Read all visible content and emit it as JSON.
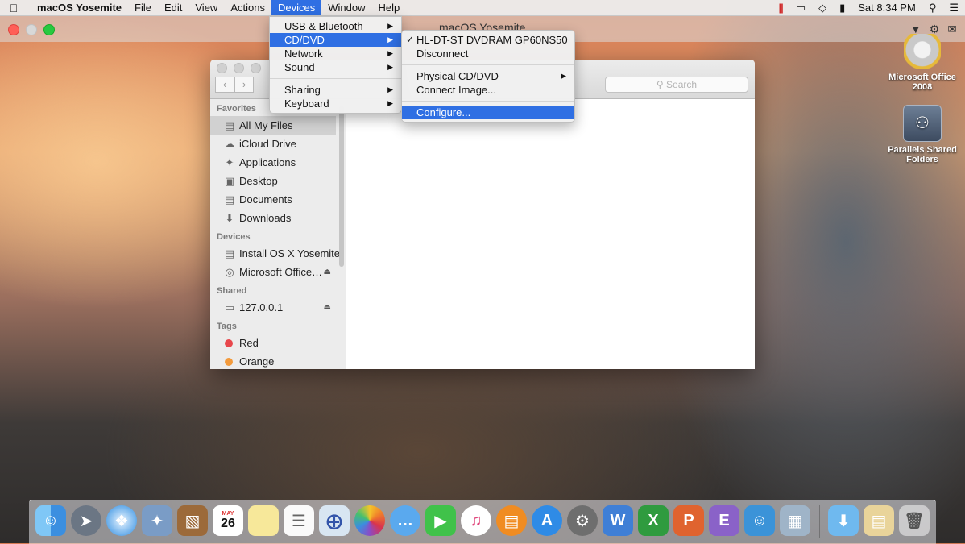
{
  "menubar": {
    "apple": "",
    "app_name": "macOS Yosemite",
    "items": [
      "File",
      "Edit",
      "View",
      "Actions",
      "Devices",
      "Window",
      "Help"
    ],
    "clock": "Sat 8:34 PM"
  },
  "parallels": {
    "title": "macOS Yosemite"
  },
  "finder": {
    "search_placeholder": "Search",
    "sections": {
      "favorites": "Favorites",
      "devices": "Devices",
      "shared": "Shared",
      "tags": "Tags"
    },
    "favorites": [
      "All My Files",
      "iCloud Drive",
      "Applications",
      "Desktop",
      "Documents",
      "Downloads"
    ],
    "devices": [
      "Install OS X Yosemite",
      "Microsoft Office…"
    ],
    "shared": [
      "127.0.0.1"
    ],
    "tags": [
      {
        "name": "Red",
        "color": "#e8474c"
      },
      {
        "name": "Orange",
        "color": "#f39a3b"
      }
    ]
  },
  "devices_menu": {
    "items": [
      "USB & Bluetooth",
      "CD/DVD",
      "Network",
      "Sound",
      "Sharing",
      "Keyboard"
    ]
  },
  "cddvd_menu": {
    "drive": "HL-DT-ST DVDRAM GP60NS50",
    "disconnect": "Disconnect",
    "physical": "Physical CD/DVD",
    "connect_image": "Connect Image...",
    "configure": "Configure..."
  },
  "desktop": {
    "icon1": "Microsoft Office 2008",
    "icon2": "Parallels Shared Folders"
  },
  "dock": {
    "calendar_month": "MAY",
    "calendar_day": "26"
  },
  "colors": {
    "accent": "#2f6fe3",
    "tag_red": "#e8474c",
    "tag_orange": "#f39a3b"
  }
}
